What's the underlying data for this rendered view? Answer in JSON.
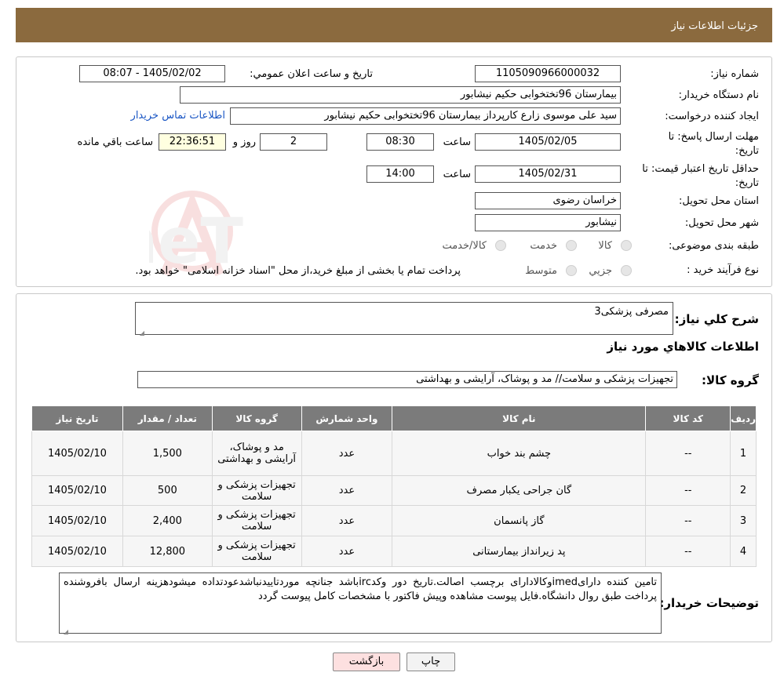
{
  "header": {
    "title": "جزئیات اطلاعات نیاز"
  },
  "form": {
    "need_number_label": "شماره نیاز:",
    "need_number": "1105090966000032",
    "announce_label": "تاریخ و ساعت اعلان عمومي:",
    "announce_value": "1405/02/02 - 08:07",
    "buyer_org_label": "نام دستگاه خریدار:",
    "buyer_org": "بیمارستان 96تختخوابی حکیم نیشابور",
    "creator_label": "ایجاد کننده درخواست:",
    "creator": "سید علی  موسوی زارع کارپرداز بیمارستان 96تختخوابی حکیم نیشابور",
    "contact_link": "اطلاعات تماس خریدار",
    "deadline_label_1": "مهلت ارسال پاسخ: تا",
    "deadline_label_2": "تاریخ:",
    "deadline_date": "1405/02/05",
    "time_label": "ساعت",
    "deadline_time": "08:30",
    "days_value": "2",
    "days_label": "روز و",
    "remaining_time": "22:36:51",
    "remaining_label": "ساعت باقي مانده",
    "validity_label_1": "حداقل تاریخ اعتبار قیمت: تا",
    "validity_label_2": "تاریخ:",
    "validity_date": "1405/02/31",
    "validity_time": "14:00",
    "province_label": "استان محل تحویل:",
    "province": "خراسان رضوی",
    "city_label": "شهر محل تحویل:",
    "city": "نیشابور",
    "category_label": "طبقه بندی موضوعی:",
    "category_options": [
      "کالا",
      "خدمت",
      "کالا/خدمت"
    ],
    "process_label": "نوع فرآیند خرید :",
    "process_options": [
      "جزیي",
      "متوسط"
    ],
    "process_note": "پرداخت تمام یا بخشی از مبلغ خرید،از محل \"اسناد خزانه اسلامی\" خواهد بود."
  },
  "watermark": {
    "text": "AriaTender.neT"
  },
  "details": {
    "summary_label": "شرح کلي نیاز:",
    "summary": "مصرفی پزشکی3",
    "goods_info_title": "اطلاعات کالاهاي مورد نیاز",
    "goods_group_label": "گروه کالا:",
    "goods_group": "تجهیزات پزشکی و سلامت// مد و پوشاک، آرایشی و بهداشتی",
    "table_headers": [
      "ردیف",
      "کد کالا",
      "نام کالا",
      "واحد شمارش",
      "گروه کالا",
      "تعداد / مقدار",
      "تاریخ نیاز"
    ],
    "rows": [
      {
        "idx": "1",
        "code": "--",
        "name": "چشم بند خواب",
        "unit": "عدد",
        "group": "مد و پوشاک، آرایشی و بهداشتی",
        "qty": "1,500",
        "date": "1405/02/10"
      },
      {
        "idx": "2",
        "code": "--",
        "name": "گان جراحی یکبار مصرف",
        "unit": "عدد",
        "group": "تجهیزات پزشکی و سلامت",
        "qty": "500",
        "date": "1405/02/10"
      },
      {
        "idx": "3",
        "code": "--",
        "name": "گاز پانسمان",
        "unit": "عدد",
        "group": "تجهیزات پزشکی و سلامت",
        "qty": "2,400",
        "date": "1405/02/10"
      },
      {
        "idx": "4",
        "code": "--",
        "name": "پد زیرانداز بیمارستانی",
        "unit": "عدد",
        "group": "تجهیزات پزشکی و سلامت",
        "qty": "12,800",
        "date": "1405/02/10"
      }
    ],
    "buyer_notes_label": "توضیحات خریدار:",
    "buyer_notes": "تامین کننده دارایimedوکالادارای برچسب اصالت.تاریخ دور وکدircباشد جنانچه موردتاییدنباشدعودتداده میشودهزینه ارسال بافروشنده پرداخت طبق روال دانشگاه.فایل پیوست مشاهده وپیش فاکتور با مشخصات کامل پیوست گردد"
  },
  "buttons": {
    "print": "چاپ",
    "back": "بازگشت"
  }
}
